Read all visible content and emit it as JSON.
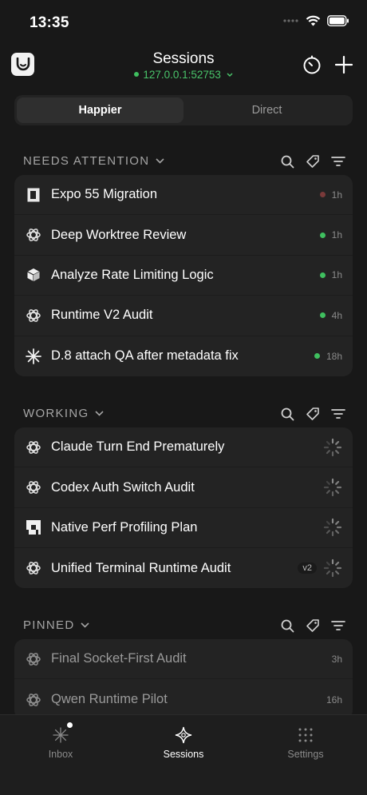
{
  "status_bar": {
    "time": "13:35"
  },
  "header": {
    "title": "Sessions",
    "server": "127.0.0.1:52753",
    "server_status_color": "#3fbf5f"
  },
  "segments": [
    {
      "label": "Happier",
      "active": true
    },
    {
      "label": "Direct",
      "active": false
    }
  ],
  "sections": {
    "needs_attention": {
      "title": "NEEDS ATTENTION",
      "items": [
        {
          "label": "Expo 55 Migration",
          "icon": "document-icon",
          "status_color": "#7a3a3a",
          "time": "1h"
        },
        {
          "label": "Deep Worktree Review",
          "icon": "openai-icon",
          "status_color": "#3fbf5f",
          "time": "1h"
        },
        {
          "label": "Analyze Rate Limiting Logic",
          "icon": "cube-icon",
          "status_color": "#3fbf5f",
          "time": "1h"
        },
        {
          "label": "Runtime V2 Audit",
          "icon": "openai-icon",
          "status_color": "#3fbf5f",
          "time": "4h"
        },
        {
          "label": "D.8 attach QA after metadata fix",
          "icon": "sparkle-icon",
          "status_color": "#3fbf5f",
          "time": "18h"
        }
      ]
    },
    "working": {
      "title": "WORKING",
      "items": [
        {
          "label": "Claude Turn End Prematurely",
          "icon": "openai-icon"
        },
        {
          "label": "Codex Auth Switch Audit",
          "icon": "openai-icon"
        },
        {
          "label": "Native Perf Profiling Plan",
          "icon": "pixel-icon"
        },
        {
          "label": "Unified Terminal Runtime Audit",
          "icon": "openai-icon",
          "badge": "v2"
        }
      ]
    },
    "pinned": {
      "title": "PINNED",
      "items": [
        {
          "label": "Final Socket-First Audit",
          "icon": "openai-icon",
          "time": "3h"
        },
        {
          "label": "Qwen Runtime Pilot",
          "icon": "openai-icon",
          "time": "16h"
        }
      ]
    }
  },
  "tabbar": {
    "inbox": "Inbox",
    "sessions": "Sessions",
    "settings": "Settings"
  }
}
